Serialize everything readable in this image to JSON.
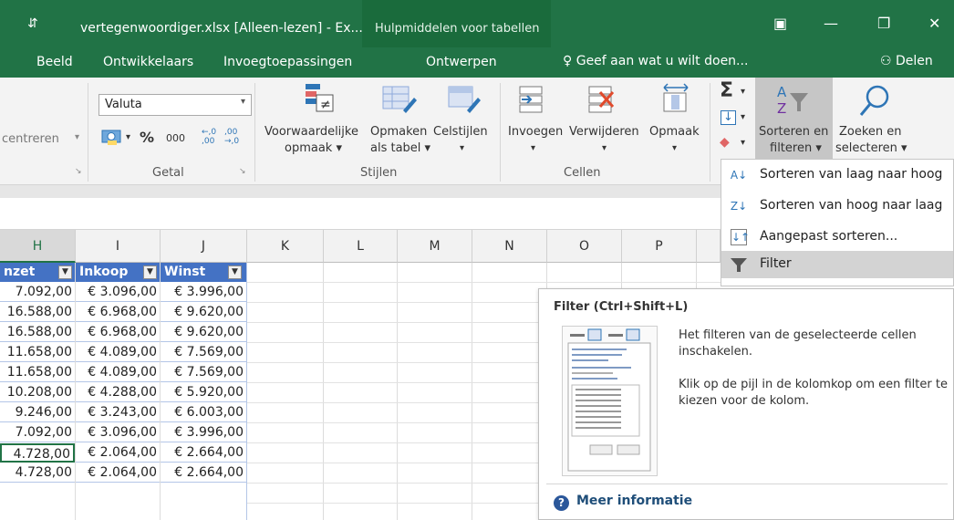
{
  "window": {
    "qat_symbol": "⇵",
    "title": "vertegenwoordiger.xlsx [Alleen-lezen] - Ex...",
    "context_tab_group": "Hulpmiddelen voor tabellen",
    "controls": {
      "ribbon_display": "▣",
      "minimize": "—",
      "restore": "❐",
      "close": "✕"
    }
  },
  "tabs": {
    "items": [
      "Beeld",
      "Ontwikkelaars",
      "Invoegtoepassingen",
      "Ontwerpen"
    ],
    "tell_me": "Geef aan wat u wilt doen...",
    "share": "Delen"
  },
  "ribbon": {
    "align": {
      "merge_label": "centreren"
    },
    "number": {
      "format_value": "Valuta",
      "percent": "%",
      "thousands": "000",
      "inc_decimal": "←,0 ,00",
      "dec_decimal": ",00 →,0",
      "group_title": "Getal"
    },
    "styles": {
      "cond_format": [
        "Voorwaardelijke",
        "opmaak ▾"
      ],
      "format_table": [
        "Opmaken",
        "als tabel ▾"
      ],
      "cell_styles": [
        "Celstijlen",
        "▾"
      ],
      "group_title": "Stijlen"
    },
    "cells": {
      "insert": [
        "Invoegen",
        "▾"
      ],
      "delete": [
        "Verwijderen",
        "▾"
      ],
      "format": [
        "Opmaak",
        "▾"
      ],
      "group_title": "Cellen"
    },
    "editing": {
      "sort_filter": [
        "Sorteren en",
        "filteren ▾"
      ],
      "find_select": [
        "Zoeken en",
        "selecteren ▾"
      ]
    }
  },
  "grid": {
    "columns": [
      "H",
      "I",
      "J",
      "K",
      "L",
      "M",
      "N",
      "O",
      "P"
    ],
    "headers": [
      "nzet",
      "Inkoop",
      "Winst"
    ],
    "rows": [
      [
        "7.092,00",
        "€ 3.096,00",
        "€ 3.996,00"
      ],
      [
        "16.588,00",
        "€ 6.968,00",
        "€ 9.620,00"
      ],
      [
        "16.588,00",
        "€ 6.968,00",
        "€ 9.620,00"
      ],
      [
        "11.658,00",
        "€ 4.089,00",
        "€ 7.569,00"
      ],
      [
        "11.658,00",
        "€ 4.089,00",
        "€ 7.569,00"
      ],
      [
        "10.208,00",
        "€ 4.288,00",
        "€ 5.920,00"
      ],
      [
        "9.246,00",
        "€ 3.243,00",
        "€ 6.003,00"
      ],
      [
        "7.092,00",
        "€ 3.096,00",
        "€ 3.996,00"
      ],
      [
        "4.728,00",
        "€ 2.064,00",
        "€ 2.664,00"
      ],
      [
        "4.728,00",
        "€ 2.064,00",
        "€ 2.664,00"
      ]
    ]
  },
  "menu": {
    "items": [
      {
        "label": "Sorteren van laag naar hoog",
        "icon": "A→Z"
      },
      {
        "label": "Sorteren van hoog naar laag",
        "icon": "Z→A"
      },
      {
        "label": "Aangepast sorteren...",
        "icon": "↓↑"
      },
      {
        "label": "Filter",
        "icon": "funnel"
      }
    ]
  },
  "tooltip": {
    "title": "Filter (Ctrl+Shift+L)",
    "desc1": "Het filteren van de geselecteerde cellen inschakelen.",
    "desc2": "Klik op de pijl in de kolomkop om een filter te kiezen voor de kolom.",
    "more_info": "Meer informatie"
  }
}
